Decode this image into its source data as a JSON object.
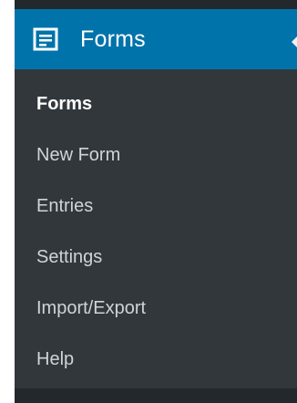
{
  "menu": {
    "header": {
      "title": "Forms",
      "icon": "form-icon"
    },
    "items": [
      {
        "label": "Forms",
        "current": true
      },
      {
        "label": "New Form",
        "current": false
      },
      {
        "label": "Entries",
        "current": false
      },
      {
        "label": "Settings",
        "current": false
      },
      {
        "label": "Import/Export",
        "current": false
      },
      {
        "label": "Help",
        "current": false
      }
    ]
  },
  "colors": {
    "header_bg": "#0073aa",
    "menu_bg": "#32373c",
    "strip_bg": "#23282d",
    "item_text": "#d0d4d8",
    "current_text": "#ffffff"
  }
}
